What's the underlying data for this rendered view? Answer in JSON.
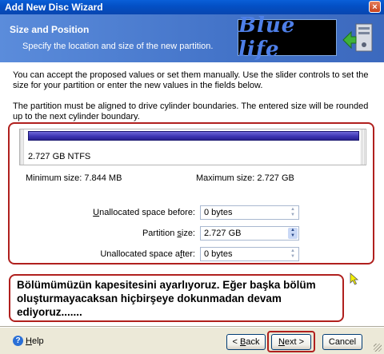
{
  "window": {
    "title": "Add New Disc Wizard",
    "close": "×"
  },
  "header": {
    "title": "Size and Position",
    "subtitle": "Specify the location and size of the new partition.",
    "logo_text": "Blue life"
  },
  "content": {
    "intro": "You can accept the proposed values or set them manually. Use the slider controls to set the size for your partition or enter the new values in the fields below.",
    "alignment_note": "The partition must be aligned to drive cylinder boundaries. The entered size will be rounded up to the next cylinder boundary."
  },
  "disk_map": {
    "partition_label": "2.727 GB  NTFS"
  },
  "limits": {
    "min_label": "Minimum size:  7.844 MB",
    "max_label": "Maximum size:  2.727 GB"
  },
  "fields": {
    "before": {
      "label_pre": "",
      "label_key": "U",
      "label_post": "nallocated space before:",
      "value": "0 bytes"
    },
    "size": {
      "label_pre": "Partition ",
      "label_key": "s",
      "label_post": "ize:",
      "value": "2.727 GB"
    },
    "after": {
      "label_pre": "Unallocated space a",
      "label_key": "f",
      "label_post": "ter:",
      "value": "0 bytes"
    }
  },
  "note": "Bölümümüzün kapesitesini ayarlıyoruz. Eğer başka bölüm oluşturmayacaksan hiçbirşeye dokunmadan devam ediyoruz.......",
  "footer": {
    "help_key": "H",
    "help_rest": "elp",
    "back_pre": "< ",
    "back_key": "B",
    "back_rest": "ack",
    "next_key": "N",
    "next_rest": "ext >",
    "cancel": "Cancel"
  },
  "colors": {
    "accent": "#B0201E",
    "header_blue": "#4373C8",
    "bar_blue": "#3A32B0"
  }
}
